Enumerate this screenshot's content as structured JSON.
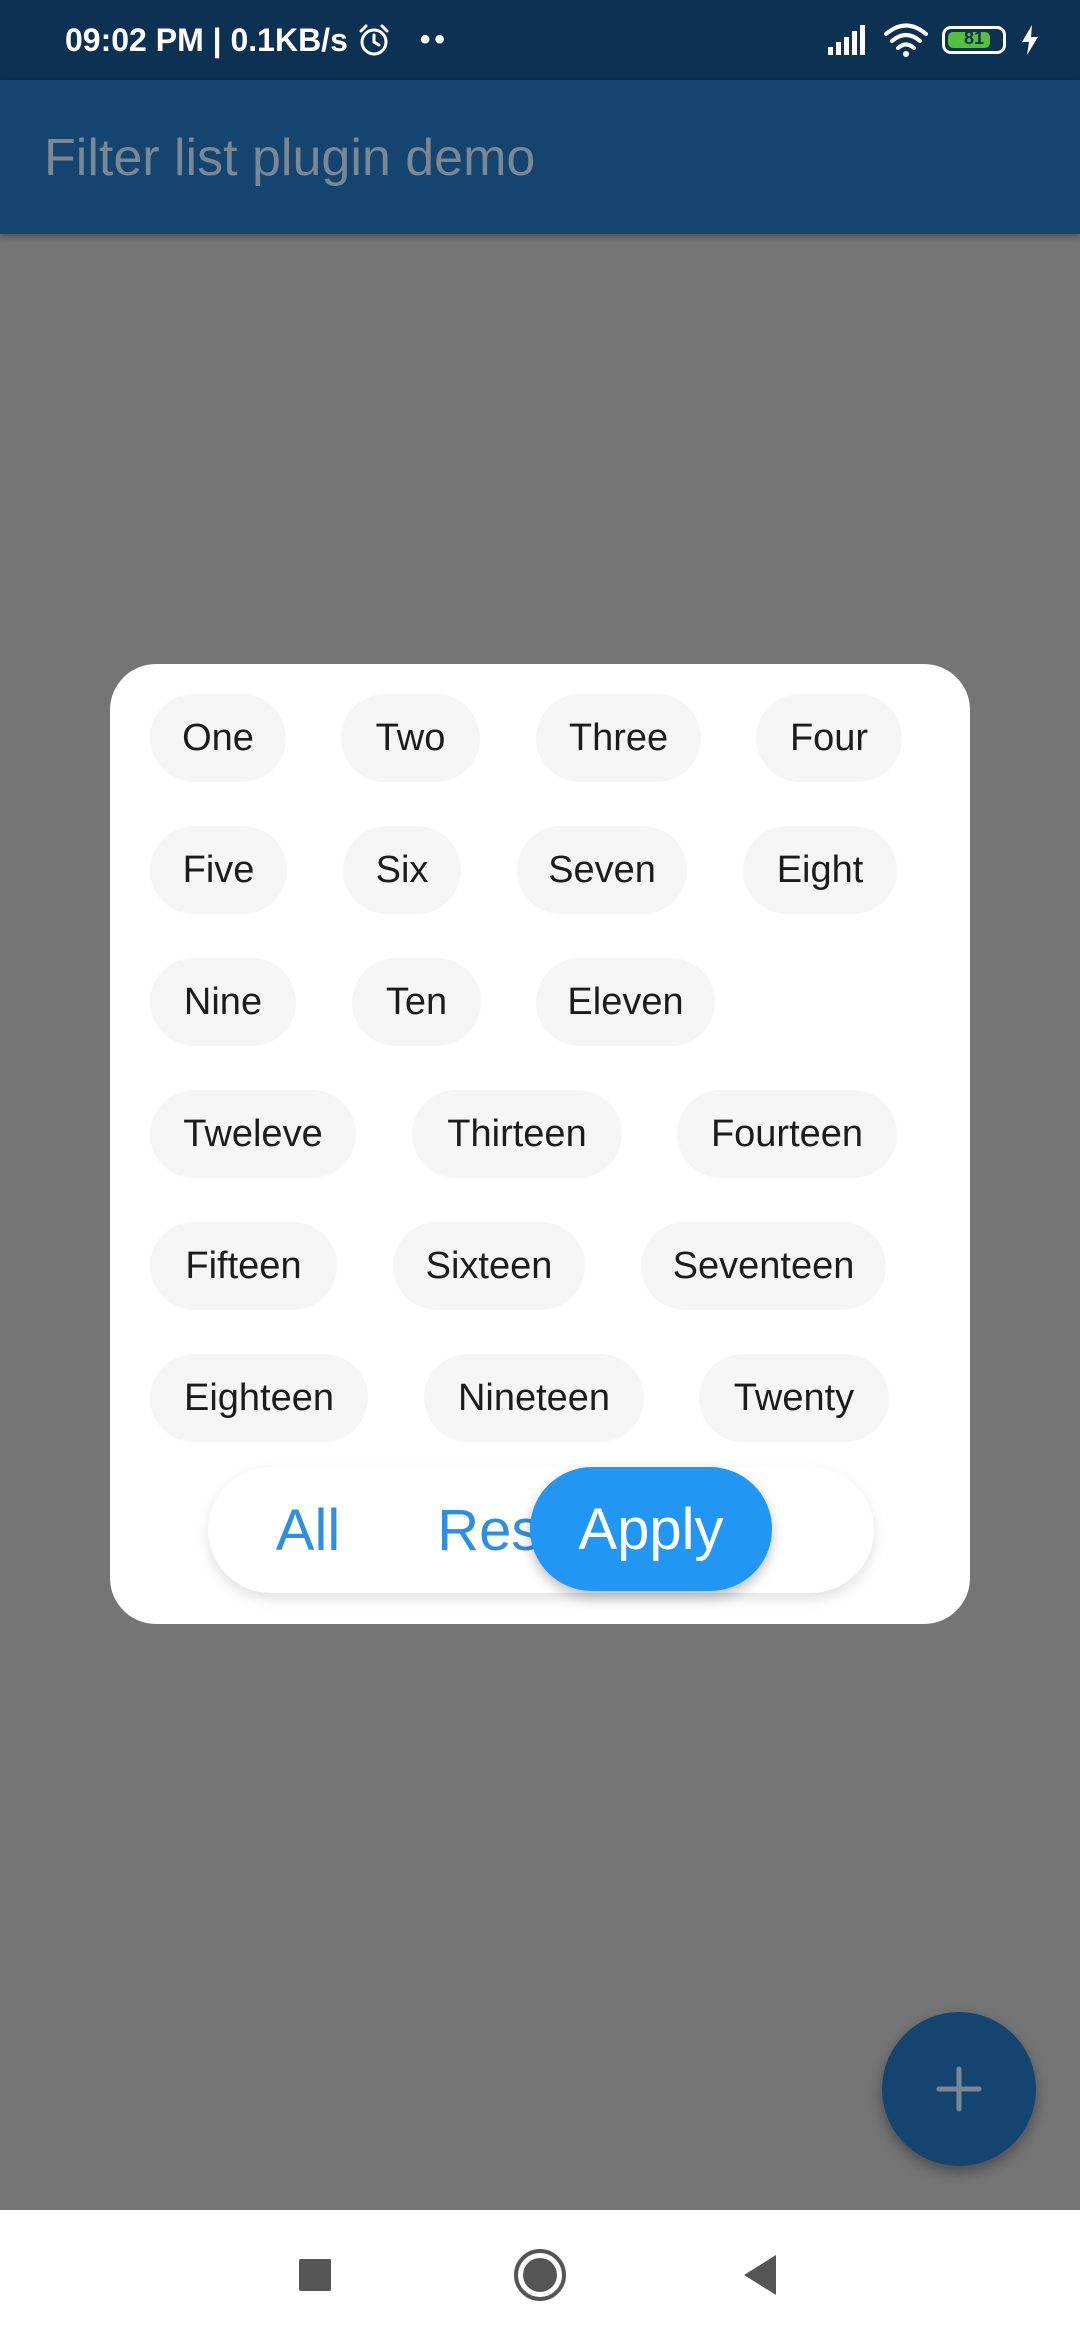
{
  "status_bar": {
    "time_speed": "09:02 PM | 0.1KB/s",
    "dots": "••",
    "battery_level": "81",
    "battery_fraction": 0.81,
    "battery_color": "#55c03c"
  },
  "app_bar": {
    "title": "Filter list plugin demo",
    "background": "#144570"
  },
  "filter_dialog": {
    "chips": [
      "One",
      "Two",
      "Three",
      "Four",
      "Five",
      "Six",
      "Seven",
      "Eight",
      "Nine",
      "Ten",
      "Eleven",
      "Tweleve",
      "Thirteen",
      "Fourteen",
      "Fifteen",
      "Sixteen",
      "Seventeen",
      "Eighteen",
      "Nineteen",
      "Twenty"
    ],
    "all_label": "All",
    "reset_label": "Reset",
    "apply_label": "Apply",
    "accent": "#2196f3"
  },
  "fab": {
    "icon": "plus-icon"
  },
  "nav_bar": {
    "icons": [
      "recents-square-icon",
      "home-circle-icon",
      "back-triangle-icon"
    ]
  }
}
